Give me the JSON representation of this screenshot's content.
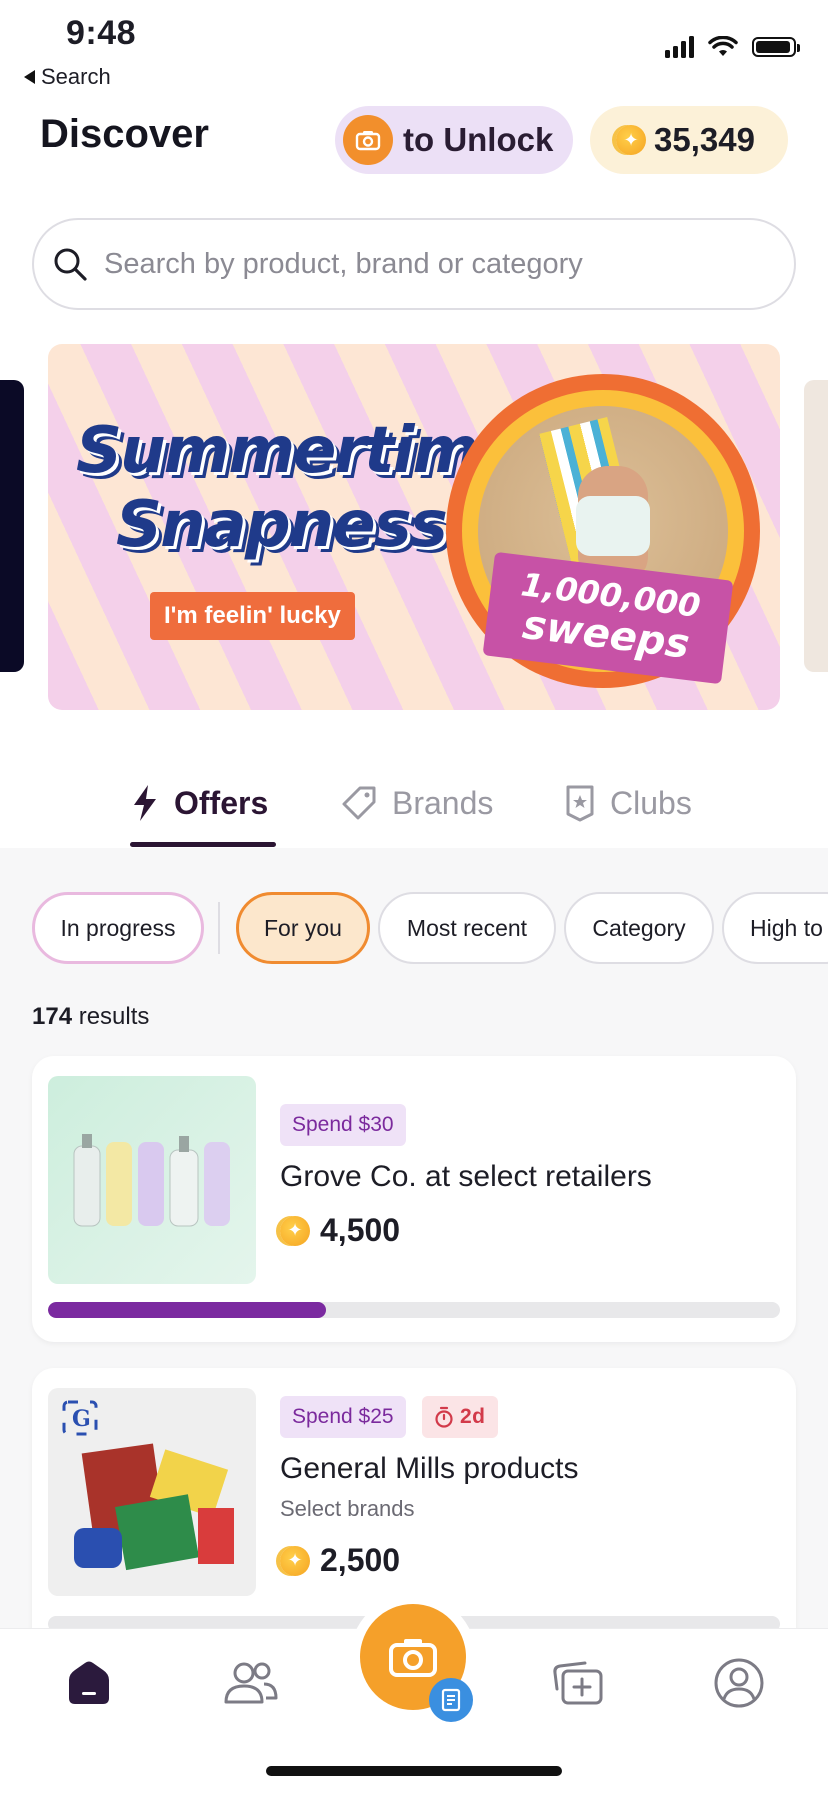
{
  "status_bar": {
    "time": "9:48",
    "back_label": "Search"
  },
  "header": {
    "title": "Discover",
    "unlock_label": "to Unlock",
    "points_balance": "35,349"
  },
  "search": {
    "placeholder": "Search by product, brand or category"
  },
  "banner": {
    "title_line1": "Summertime",
    "title_line2": "Snapness",
    "button_label": "I'm feelin' lucky",
    "sweeps_amount": "1,000,000",
    "sweeps_label": "sweeps"
  },
  "tabs": [
    {
      "label": "Offers",
      "active": true
    },
    {
      "label": "Brands",
      "active": false
    },
    {
      "label": "Clubs",
      "active": false
    }
  ],
  "filters": [
    {
      "label": "In progress"
    },
    {
      "label": "For you",
      "selected": true
    },
    {
      "label": "Most recent"
    },
    {
      "label": "Category"
    },
    {
      "label": "High to"
    }
  ],
  "results": {
    "count": "174",
    "label": "results"
  },
  "offers": [
    {
      "spend": "Spend $30",
      "title": "Grove Co. at select retailers",
      "points": "4,500",
      "progress": 0.38
    },
    {
      "spend": "Spend $25",
      "time_left": "2d",
      "title": "General Mills products",
      "subtitle": "Select brands",
      "points": "2,500"
    }
  ],
  "colors": {
    "accent_purple": "#7b2aa0",
    "accent_orange": "#f5a02a",
    "coin": "#f5a321"
  }
}
